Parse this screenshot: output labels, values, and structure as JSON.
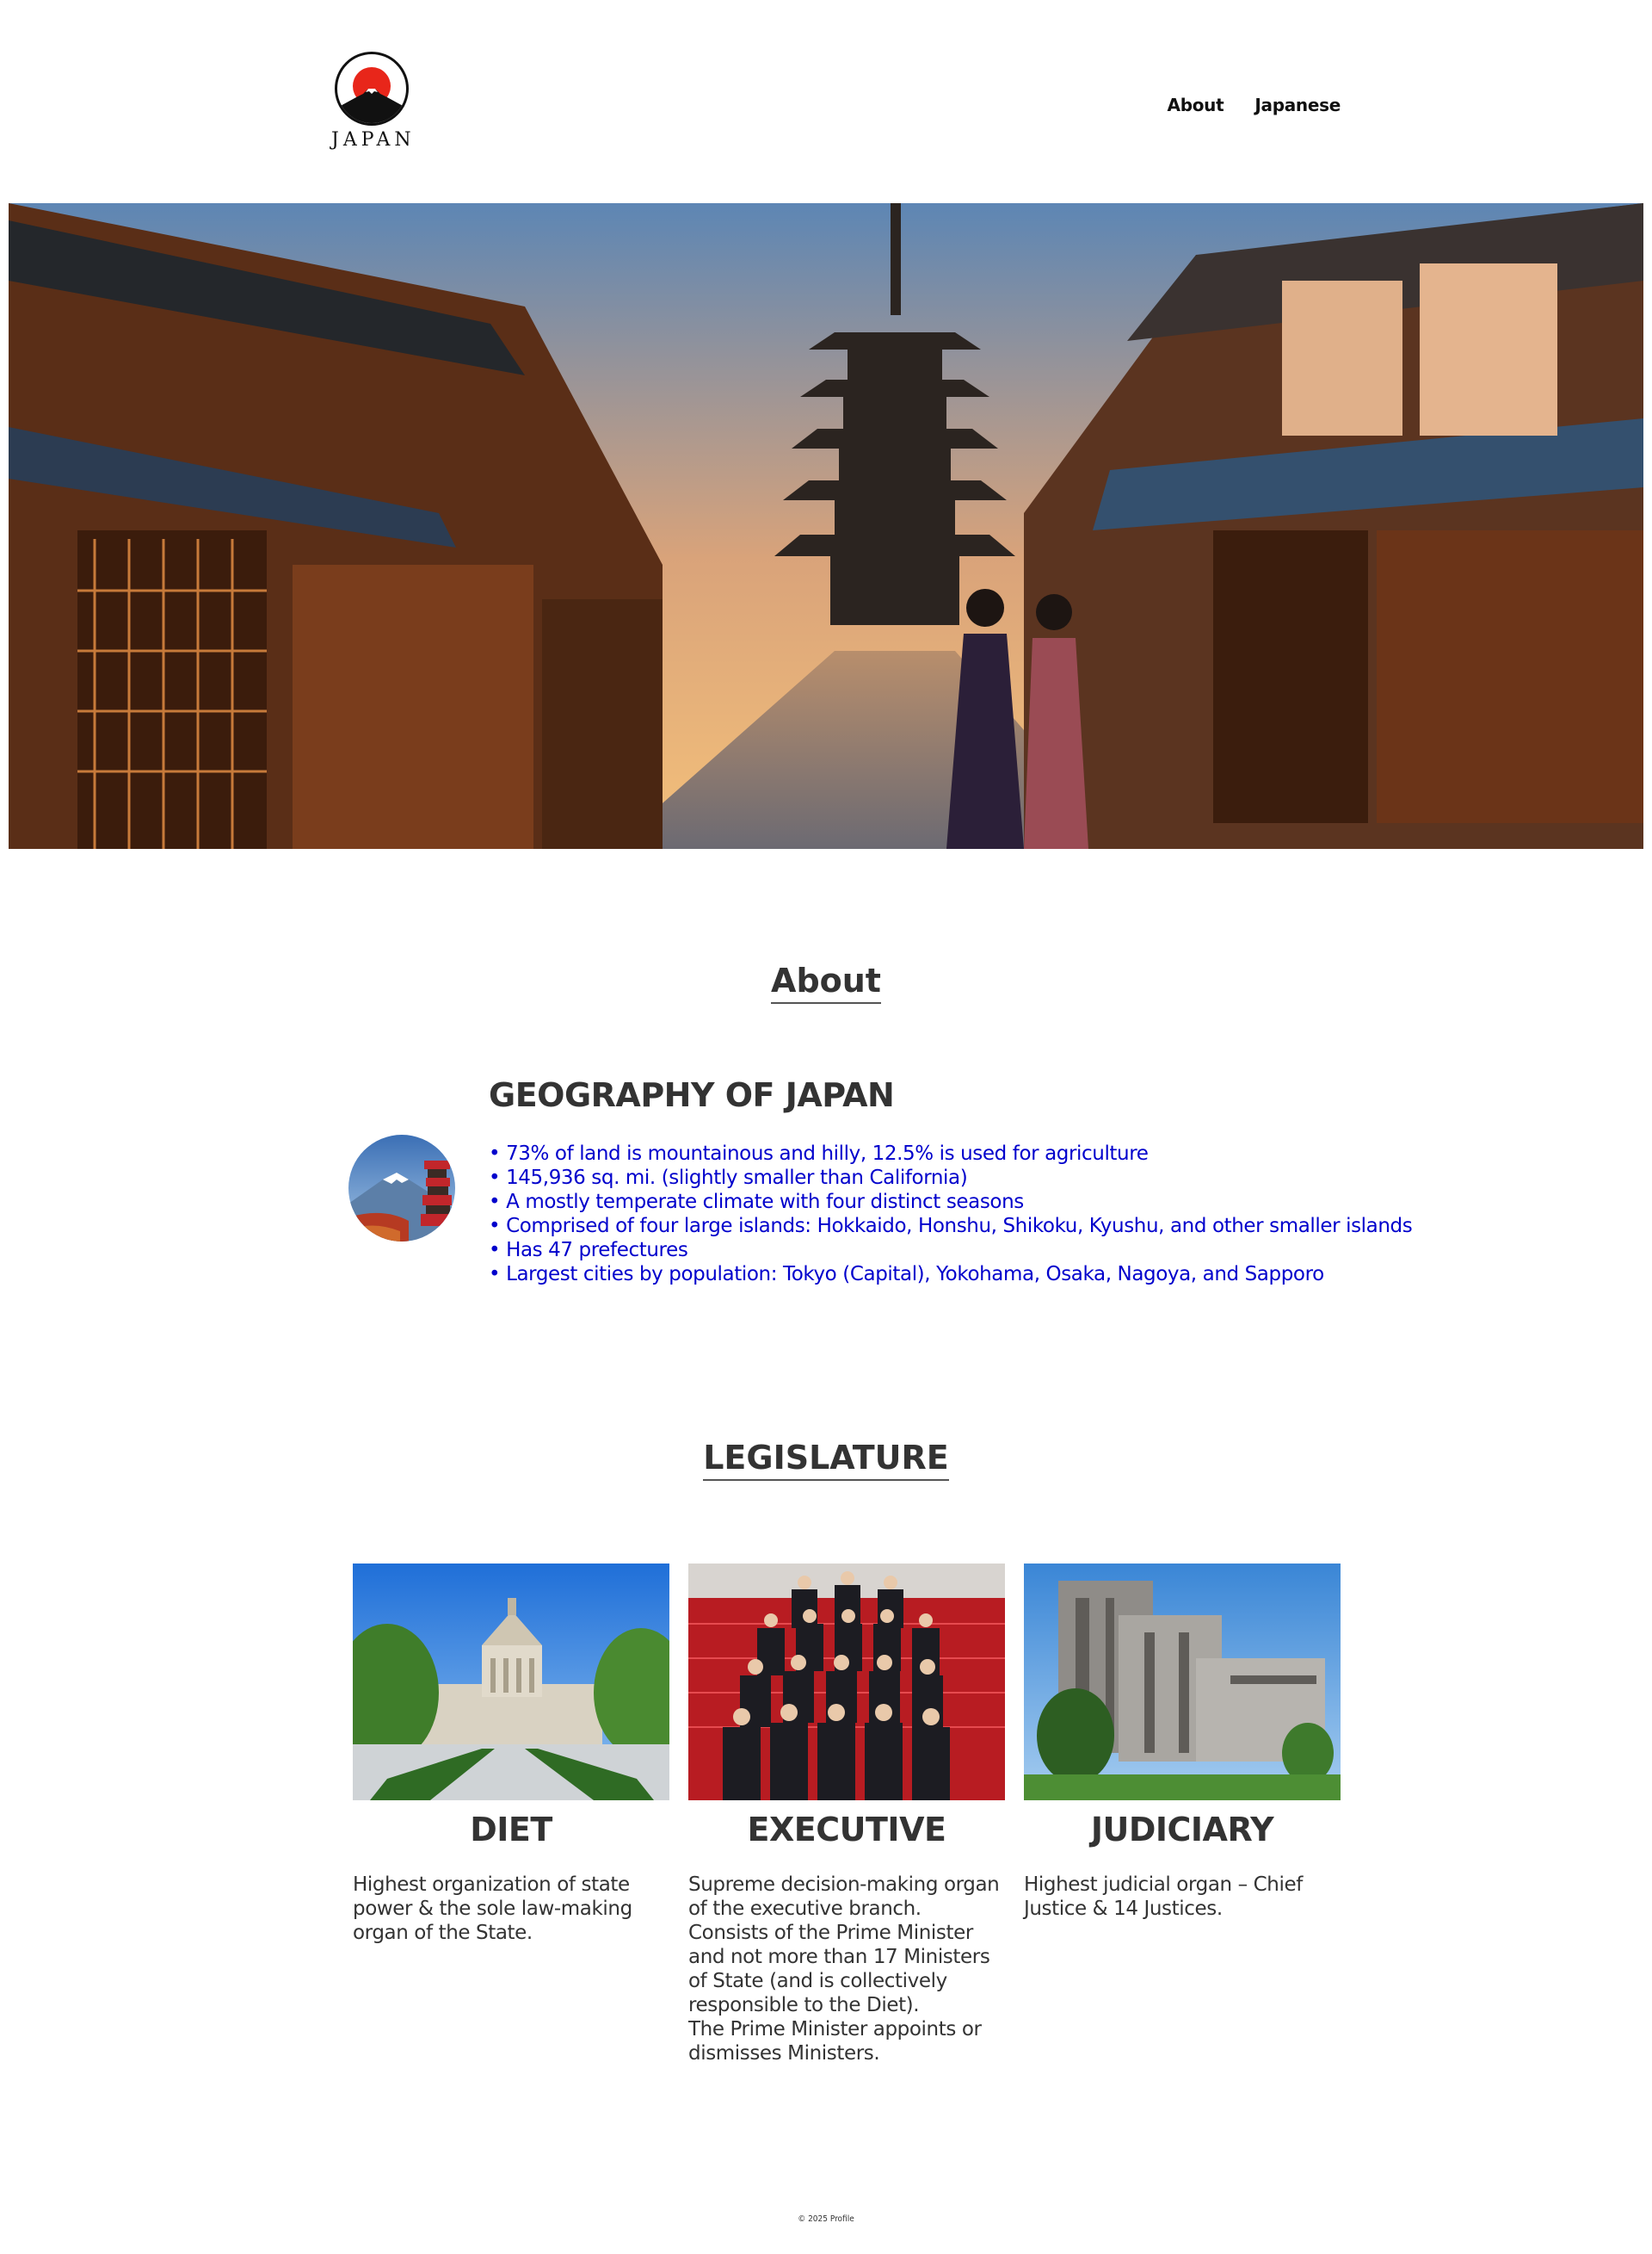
{
  "logo": {
    "text": "JAPAN",
    "icon": "mount-fuji-rising-sun-icon"
  },
  "nav": {
    "items": [
      "About",
      "Japanese"
    ]
  },
  "hero": {
    "image": "kyoto-street-pagoda-photo"
  },
  "about": {
    "title": "About"
  },
  "geography": {
    "heading": "GEOGRAPHY OF JAPAN",
    "image": "mount-fuji-pagoda-photo",
    "facts": [
      "• 73% of land is mountainous and hilly, 12.5% is used for agriculture",
      "• 145,936 sq. mi. (slightly smaller than California)",
      "• A mostly temperate climate with four distinct seasons",
      "• Comprised of four large islands: Hokkaido, Honshu, Shikoku, Kyushu, and other smaller islands",
      "• Has 47 prefectures",
      "• Largest cities by population: Tokyo (Capital), Yokohama, Osaka, Nagoya, and Sapporo"
    ]
  },
  "legislature": {
    "title": "LEGISLATURE",
    "cards": [
      {
        "title": "DIET",
        "image": "national-diet-building-photo",
        "lines": [
          "Highest organization of state power & the sole law-making organ of the State."
        ]
      },
      {
        "title": "EXECUTIVE",
        "image": "cabinet-group-photo",
        "lines": [
          "Supreme decision-making organ of the executive branch.",
          "Consists of the Prime Minister and not more than 17 Ministers of State (and is collectively responsible to the Diet).",
          "The Prime Minister appoints or dismisses Ministers."
        ]
      },
      {
        "title": "JUDICIARY",
        "image": "supreme-court-building-photo",
        "lines": [
          "Highest judicial organ – Chief Justice & 14 Justices."
        ]
      }
    ]
  },
  "footer": {
    "text": "© 2025 Profile"
  },
  "colors": {
    "fact_text": "#0000cc",
    "heading": "#333333",
    "sun": "#e8261a"
  }
}
